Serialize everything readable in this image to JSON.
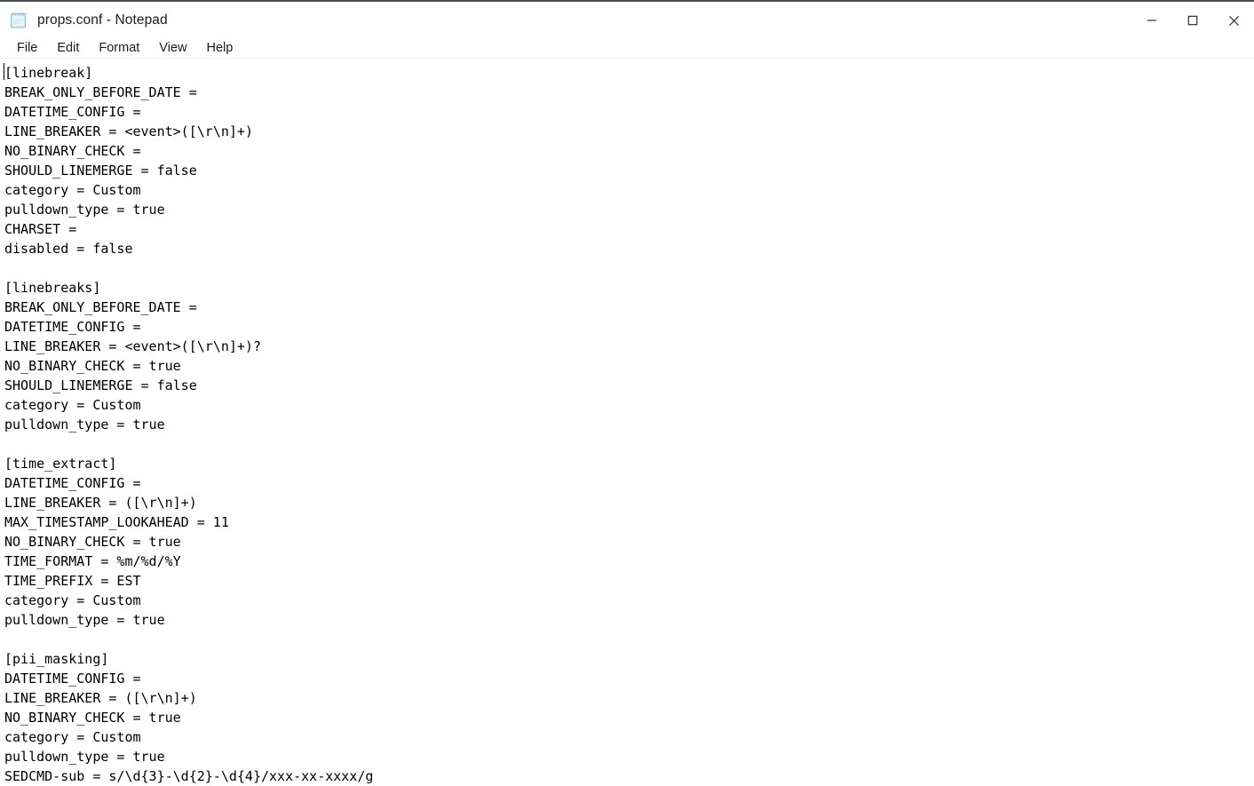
{
  "window": {
    "title": "props.conf - Notepad",
    "app_icon": "notepad-icon",
    "controls": {
      "minimize_label": "Minimize",
      "maximize_label": "Maximize",
      "close_label": "Close"
    }
  },
  "menubar": {
    "items": [
      {
        "label": "File"
      },
      {
        "label": "Edit"
      },
      {
        "label": "Format"
      },
      {
        "label": "View"
      },
      {
        "label": "Help"
      }
    ]
  },
  "editor": {
    "text": "[linebreak]\nBREAK_ONLY_BEFORE_DATE =\nDATETIME_CONFIG =\nLINE_BREAKER = <event>([\\r\\n]+)\nNO_BINARY_CHECK =\nSHOULD_LINEMERGE = false\ncategory = Custom\npulldown_type = true\nCHARSET =\ndisabled = false\n\n[linebreaks]\nBREAK_ONLY_BEFORE_DATE =\nDATETIME_CONFIG =\nLINE_BREAKER = <event>([\\r\\n]+)?\nNO_BINARY_CHECK = true\nSHOULD_LINEMERGE = false\ncategory = Custom\npulldown_type = true\n\n[time_extract]\nDATETIME_CONFIG =\nLINE_BREAKER = ([\\r\\n]+)\nMAX_TIMESTAMP_LOOKAHEAD = 11\nNO_BINARY_CHECK = true\nTIME_FORMAT = %m/%d/%Y\nTIME_PREFIX = EST\ncategory = Custom\npulldown_type = true\n\n[pii_masking]\nDATETIME_CONFIG =\nLINE_BREAKER = ([\\r\\n]+)\nNO_BINARY_CHECK = true\ncategory = Custom\npulldown_type = true\nSEDCMD-sub = s/\\d{3}-\\d{2}-\\d{4}/xxx-xx-xxxx/g",
    "stanzas": [
      {
        "name": "[linebreak]",
        "settings": [
          {
            "key": "BREAK_ONLY_BEFORE_DATE",
            "value": ""
          },
          {
            "key": "DATETIME_CONFIG",
            "value": ""
          },
          {
            "key": "LINE_BREAKER",
            "value": "<event>([\\r\\n]+)"
          },
          {
            "key": "NO_BINARY_CHECK",
            "value": ""
          },
          {
            "key": "SHOULD_LINEMERGE",
            "value": "false"
          },
          {
            "key": "category",
            "value": "Custom"
          },
          {
            "key": "pulldown_type",
            "value": "true"
          },
          {
            "key": "CHARSET",
            "value": ""
          },
          {
            "key": "disabled",
            "value": "false"
          }
        ]
      },
      {
        "name": "[linebreaks]",
        "settings": [
          {
            "key": "BREAK_ONLY_BEFORE_DATE",
            "value": ""
          },
          {
            "key": "DATETIME_CONFIG",
            "value": ""
          },
          {
            "key": "LINE_BREAKER",
            "value": "<event>([\\r\\n]+)?"
          },
          {
            "key": "NO_BINARY_CHECK",
            "value": "true"
          },
          {
            "key": "SHOULD_LINEMERGE",
            "value": "false"
          },
          {
            "key": "category",
            "value": "Custom"
          },
          {
            "key": "pulldown_type",
            "value": "true"
          }
        ]
      },
      {
        "name": "[time_extract]",
        "settings": [
          {
            "key": "DATETIME_CONFIG",
            "value": ""
          },
          {
            "key": "LINE_BREAKER",
            "value": "([\\r\\n]+)"
          },
          {
            "key": "MAX_TIMESTAMP_LOOKAHEAD",
            "value": "11"
          },
          {
            "key": "NO_BINARY_CHECK",
            "value": "true"
          },
          {
            "key": "TIME_FORMAT",
            "value": "%m/%d/%Y"
          },
          {
            "key": "TIME_PREFIX",
            "value": "EST"
          },
          {
            "key": "category",
            "value": "Custom"
          },
          {
            "key": "pulldown_type",
            "value": "true"
          }
        ]
      },
      {
        "name": "[pii_masking]",
        "settings": [
          {
            "key": "DATETIME_CONFIG",
            "value": ""
          },
          {
            "key": "LINE_BREAKER",
            "value": "([\\r\\n]+)"
          },
          {
            "key": "NO_BINARY_CHECK",
            "value": "true"
          },
          {
            "key": "category",
            "value": "Custom"
          },
          {
            "key": "pulldown_type",
            "value": "true"
          },
          {
            "key": "SEDCMD-sub",
            "value": "s/\\d{3}-\\d{2}-\\d{4}/xxx-xx-xxxx/g"
          }
        ]
      }
    ]
  },
  "colors": {
    "window_background": "#ffffff",
    "text": "#000000",
    "top_border": "#4a4f56",
    "menu_separator": "#eeeeee",
    "close_hover": "#e81123"
  }
}
